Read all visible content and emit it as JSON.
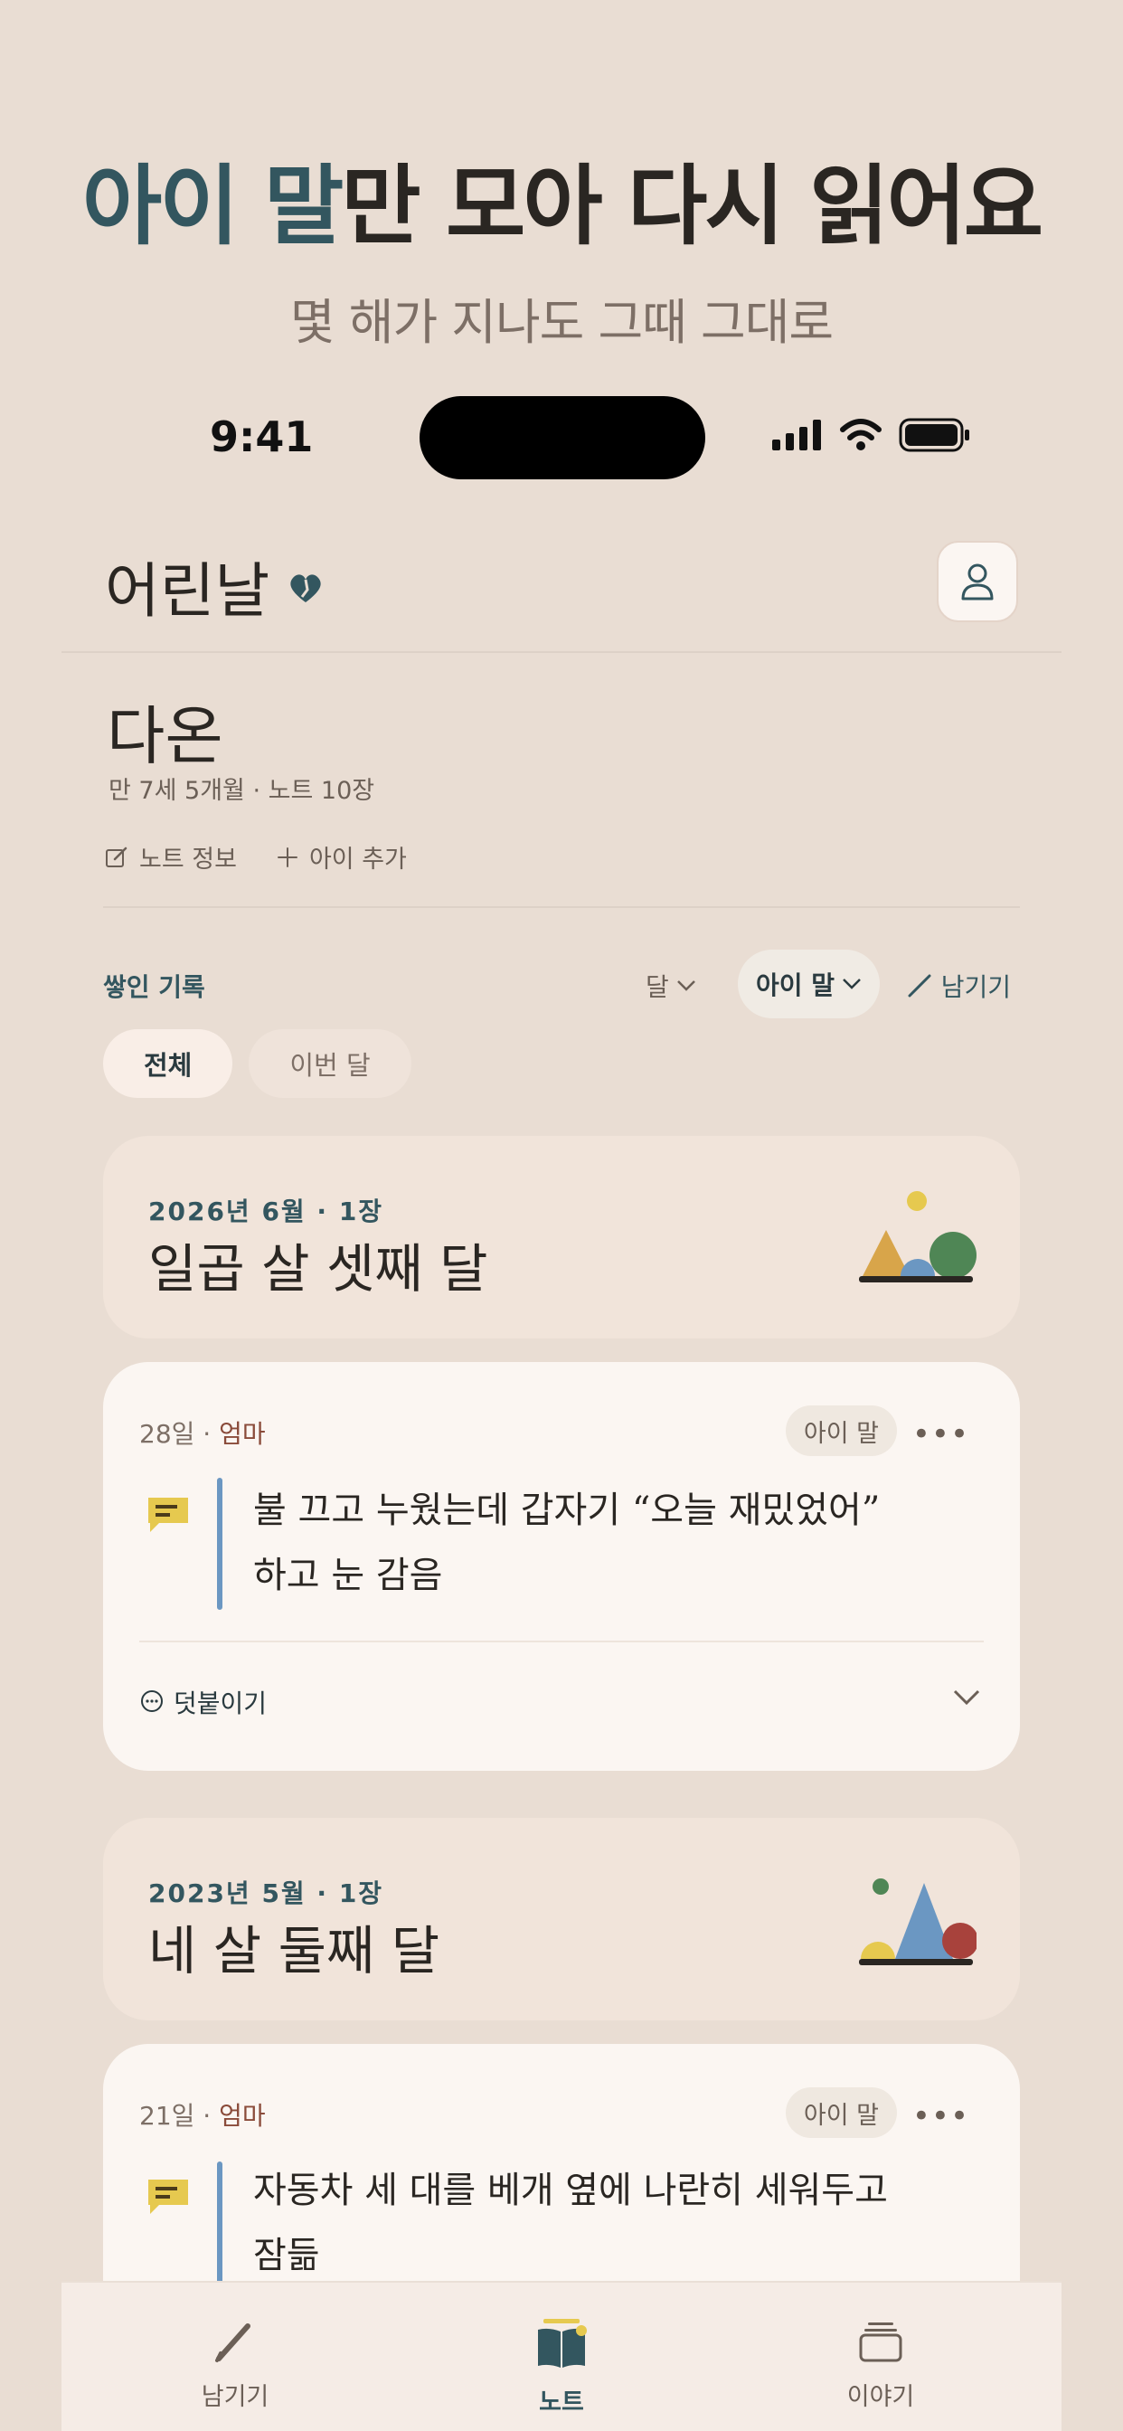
{
  "hero": {
    "title_accent": "아이 말",
    "title_rest": "만 모아 다시 읽어요",
    "subtitle": "몇 해가 지나도 그때 그대로"
  },
  "status_bar": {
    "time": "9:41"
  },
  "header": {
    "app_title": "어린날",
    "profile_icon": "person-icon"
  },
  "child": {
    "name": "다온",
    "meta": "만 7세 5개월 · 노트 10장",
    "actions": [
      {
        "label": "노트 정보",
        "icon": "edit-icon"
      },
      {
        "label": "아이 추가",
        "icon": "plus-icon"
      }
    ]
  },
  "toolbar": {
    "section_label": "쌓인 기록",
    "month_filter": "달",
    "kind_filter": "아이 말",
    "write_label": "남기기"
  },
  "chips": [
    {
      "label": "전체",
      "active": true
    },
    {
      "label": "이번 달",
      "active": false
    }
  ],
  "months": [
    {
      "meta": "2026년 6월 · 1장",
      "title": "일곱 살 셋째 달",
      "note": {
        "day": "28일",
        "author": "엄마",
        "tag": "아이 말",
        "text_line1": "불 끄고 누웠는데 갑자기 “오늘 재밌었어”",
        "text_line2": "하고 눈 감음",
        "comment_label": "덧붙이기"
      }
    },
    {
      "meta": "2023년 5월 · 1장",
      "title": "네 살 둘째 달",
      "note": {
        "day": "21일",
        "author": "엄마",
        "tag": "아이 말",
        "text_line1": "자동차 세 대를 베개 옆에 나란히 세워두고",
        "text_line2": "잠듦"
      }
    }
  ],
  "bottom_nav": [
    {
      "label": "남기기",
      "icon": "pencil-icon",
      "active": false
    },
    {
      "label": "노트",
      "icon": "book-icon",
      "active": true
    },
    {
      "label": "이야기",
      "icon": "stack-icon",
      "active": false
    }
  ],
  "colors": {
    "background": "#e9ddd3",
    "accent": "#33565f",
    "card": "#fbf6f2",
    "month_card": "#f1e4da",
    "author": "#8a4b3a",
    "quote_bar": "#6b97c2",
    "quote_icon": "#e6c94f"
  }
}
